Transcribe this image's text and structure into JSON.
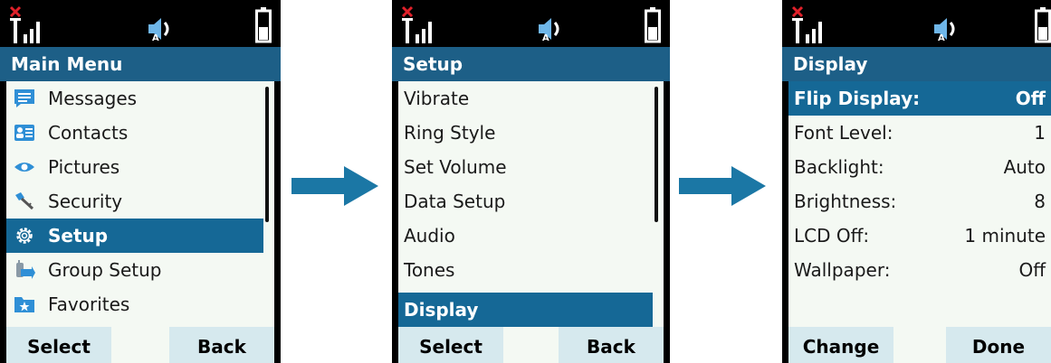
{
  "screens": [
    {
      "title": "Main Menu",
      "items": [
        {
          "label": "Messages",
          "icon": "message-icon"
        },
        {
          "label": "Contacts",
          "icon": "contact-card-icon"
        },
        {
          "label": "Pictures",
          "icon": "eye-icon"
        },
        {
          "label": "Security",
          "icon": "key-icon"
        },
        {
          "label": "Setup",
          "icon": "gear-icon",
          "selected": true
        },
        {
          "label": "Group Setup",
          "icon": "group-radio-icon"
        },
        {
          "label": "Favorites",
          "icon": "favorites-folder-icon"
        }
      ],
      "softkeys": {
        "left": "Select",
        "right": "Back"
      }
    },
    {
      "title": "Setup",
      "items": [
        {
          "label": "Vibrate"
        },
        {
          "label": "Ring Style"
        },
        {
          "label": "Set Volume"
        },
        {
          "label": "Data Setup"
        },
        {
          "label": "Audio"
        },
        {
          "label": "Tones"
        },
        {
          "label": "Display",
          "selected": true
        }
      ],
      "softkeys": {
        "left": "Select",
        "right": "Back"
      }
    },
    {
      "title": "Display",
      "items": [
        {
          "label": "Flip Display:",
          "value": "Off",
          "selected": true
        },
        {
          "label": "Font Level:",
          "value": "1"
        },
        {
          "label": "Backlight:",
          "value": "Auto"
        },
        {
          "label": "Brightness:",
          "value": "8"
        },
        {
          "label": "LCD Off:",
          "value": "1 minute"
        },
        {
          "label": "Wallpaper:",
          "value": "Off"
        }
      ],
      "softkeys": {
        "left": "Change",
        "right": "Done"
      }
    }
  ],
  "colors": {
    "title_bar": "#1d5f87",
    "selection": "#156896",
    "list_background": "#f4f9f3",
    "softkey_button": "#d6e9ee",
    "arrow": "#1b77a5"
  },
  "status_icons": [
    "signal-no-service-icon",
    "speaker-auto-icon",
    "battery-icon"
  ]
}
